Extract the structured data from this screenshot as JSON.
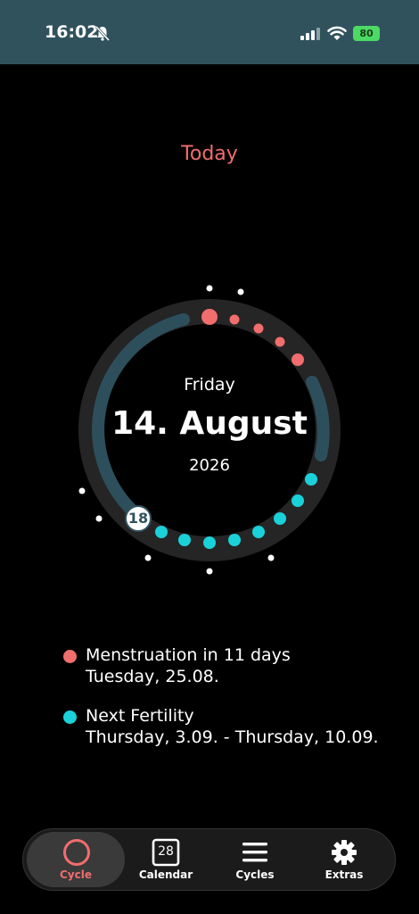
{
  "status_bar": {
    "time": "16:02",
    "battery": "80"
  },
  "header": {
    "today_label": "Today"
  },
  "dial": {
    "day_name": "Friday",
    "date": "14. August",
    "year": "2026",
    "current_cycle_day": "18"
  },
  "info": {
    "menstruation": {
      "title": "Menstruation in 11 days",
      "subtitle": "Tuesday, 25.08."
    },
    "fertility": {
      "title": "Next Fertility",
      "subtitle": "Thursday, 3.09. - Thursday, 10.09."
    }
  },
  "tabs": [
    {
      "label": "Cycle",
      "icon": "circle-icon",
      "active": true
    },
    {
      "label": "Calendar",
      "icon": "calendar-icon",
      "calendar_number": "28"
    },
    {
      "label": "Cycles",
      "icon": "list-icon"
    },
    {
      "label": "Extras",
      "icon": "gear-icon"
    }
  ],
  "colors": {
    "status_bar": "#30525d",
    "menstruation": "#f26d6d",
    "fertility": "#1ad1d9",
    "ring": "#252525",
    "progress": "#2d4f5c"
  }
}
